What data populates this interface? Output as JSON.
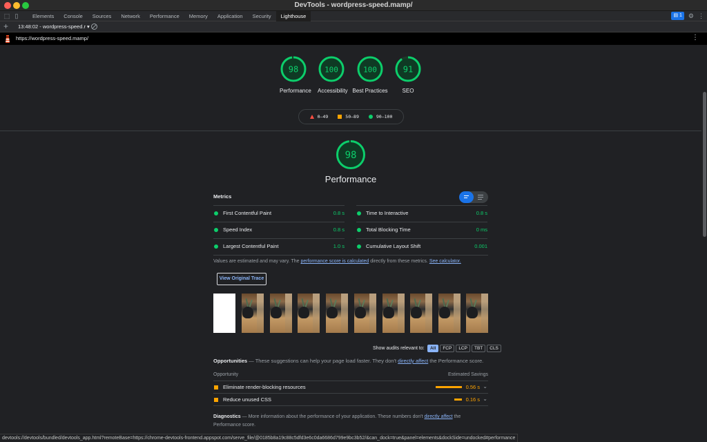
{
  "window": {
    "title": "DevTools - wordpress-speed.mamp/"
  },
  "tabs": [
    "Elements",
    "Console",
    "Sources",
    "Network",
    "Performance",
    "Memory",
    "Application",
    "Security",
    "Lighthouse"
  ],
  "active_tab": "Lighthouse",
  "toolbar": {
    "issues_count": "1",
    "report_label": "13:48:02 - wordpress-speed.r ▾"
  },
  "url": "https://wordpress-speed.mamp/",
  "scores": [
    {
      "label": "Performance",
      "value": "98",
      "score": 98
    },
    {
      "label": "Accessibility",
      "value": "100",
      "score": 100
    },
    {
      "label": "Best Practices",
      "value": "100",
      "score": 100
    },
    {
      "label": "SEO",
      "value": "91",
      "score": 91
    }
  ],
  "legend": {
    "fail": "0–49",
    "average": "50–89",
    "pass": "90–100"
  },
  "performance": {
    "score": "98",
    "title": "Performance",
    "metrics_label": "Metrics",
    "metrics": [
      {
        "name": "First Contentful Paint",
        "value": "0.8 s"
      },
      {
        "name": "Time to Interactive",
        "value": "0.8 s"
      },
      {
        "name": "Speed Index",
        "value": "0.8 s"
      },
      {
        "name": "Total Blocking Time",
        "value": "0 ms"
      },
      {
        "name": "Largest Contentful Paint",
        "value": "1.0 s"
      },
      {
        "name": "Cumulative Layout Shift",
        "value": "0.001"
      }
    ],
    "note_prefix": "Values are estimated and may vary. The ",
    "note_link": "performance score is calculated",
    "note_mid": " directly from these metrics. ",
    "note_link2": "See calculator.",
    "view_trace": "View Original Trace"
  },
  "audits_filter": {
    "label": "Show audits relevant to:",
    "chips": [
      "All",
      "FCP",
      "LCP",
      "TBT",
      "CLS"
    ]
  },
  "opportunities": {
    "title": "Opportunities",
    "dash": " — ",
    "desc_prefix": "These suggestions can help your page load faster. They don't ",
    "desc_link": "directly affect",
    "desc_suffix": " the Performance score.",
    "col_left": "Opportunity",
    "col_right": "Estimated Savings",
    "items": [
      {
        "name": "Eliminate render-blocking resources",
        "savings": "0.56 s",
        "savings_seconds": 0.56
      },
      {
        "name": "Reduce unused CSS",
        "savings": "0.16 s",
        "savings_seconds": 0.16
      }
    ]
  },
  "diagnostics": {
    "title": "Diagnostics",
    "dash": " — ",
    "desc_prefix": "More information about the performance of your application. These numbers don't ",
    "desc_link": "directly affect",
    "desc_suffix": " the Performance score."
  },
  "statusbar": "devtools://devtools/bundled/devtools_app.html?remoteBase=https://chrome-devtools-frontend.appspot.com/serve_file/@0185b8a19c88c5dfd3e6c0da6686d799e9bc3b52/&can_dock=true&panel=elements&dockSide=undocked#performance",
  "colors": {
    "pass": "#0cce6b",
    "average": "#ffa400",
    "fail": "#ff4e42",
    "accent": "#1a73e8",
    "link": "#8ab4f8"
  }
}
